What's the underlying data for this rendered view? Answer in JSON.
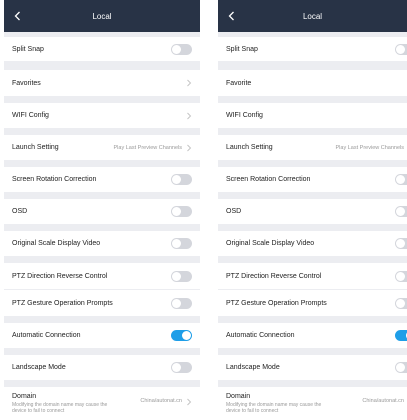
{
  "colors": {
    "header": "#283346",
    "toggle_on": "#1e9ee8",
    "toggle_off": "#d4d6dc",
    "background": "#ecedf1"
  },
  "left": {
    "title": "Local",
    "settings": {
      "split_snap": {
        "label": "Split Snap",
        "on": false
      },
      "favorites": {
        "label": "Favorites"
      },
      "wifi_config": {
        "label": "WIFI Config"
      },
      "launch_setting": {
        "label": "Launch Setting",
        "value": "Play Last Preview Channels"
      },
      "screen_rotation": {
        "label": "Screen Rotation Correction",
        "on": false
      },
      "osd": {
        "label": "OSD",
        "on": false
      },
      "original_scale": {
        "label": "Original Scale Display Video",
        "on": false
      },
      "ptz_reverse": {
        "label": "PTZ Direction Reverse Control",
        "on": false
      },
      "ptz_gesture": {
        "label": "PTZ Gesture Operation Prompts",
        "on": false
      },
      "auto_connect": {
        "label": "Automatic Connection",
        "on": true
      },
      "landscape": {
        "label": "Landscape Mode",
        "on": false
      },
      "domain": {
        "label": "Domain",
        "note": "Modifying the domain name may cause the device to fail to connect",
        "value": "China/autonat.cn"
      }
    }
  },
  "right": {
    "title": "Local",
    "settings": {
      "split_snap": {
        "label": "Split Snap",
        "on": false
      },
      "favorites": {
        "label": "Favorite"
      },
      "wifi_config": {
        "label": "WIFI Config"
      },
      "launch_setting": {
        "label": "Launch Setting",
        "value": "Play Last Preview Channels"
      },
      "screen_rotation": {
        "label": "Screen Rotation Correction",
        "on": false
      },
      "osd": {
        "label": "OSD",
        "on": false
      },
      "original_scale": {
        "label": "Original Scale Display Video",
        "on": false
      },
      "ptz_reverse": {
        "label": "PTZ Direction Reverse Control",
        "on": false
      },
      "ptz_gesture": {
        "label": "PTZ Gesture Operation Prompts",
        "on": false
      },
      "auto_connect": {
        "label": "Automatic Connection",
        "on": true
      },
      "landscape": {
        "label": "Landscape Mode",
        "on": false
      },
      "domain": {
        "label": "Domain",
        "note": "Modifying the domain name may cause the device to fail to connect",
        "value": "China/autonat.cn"
      }
    }
  }
}
